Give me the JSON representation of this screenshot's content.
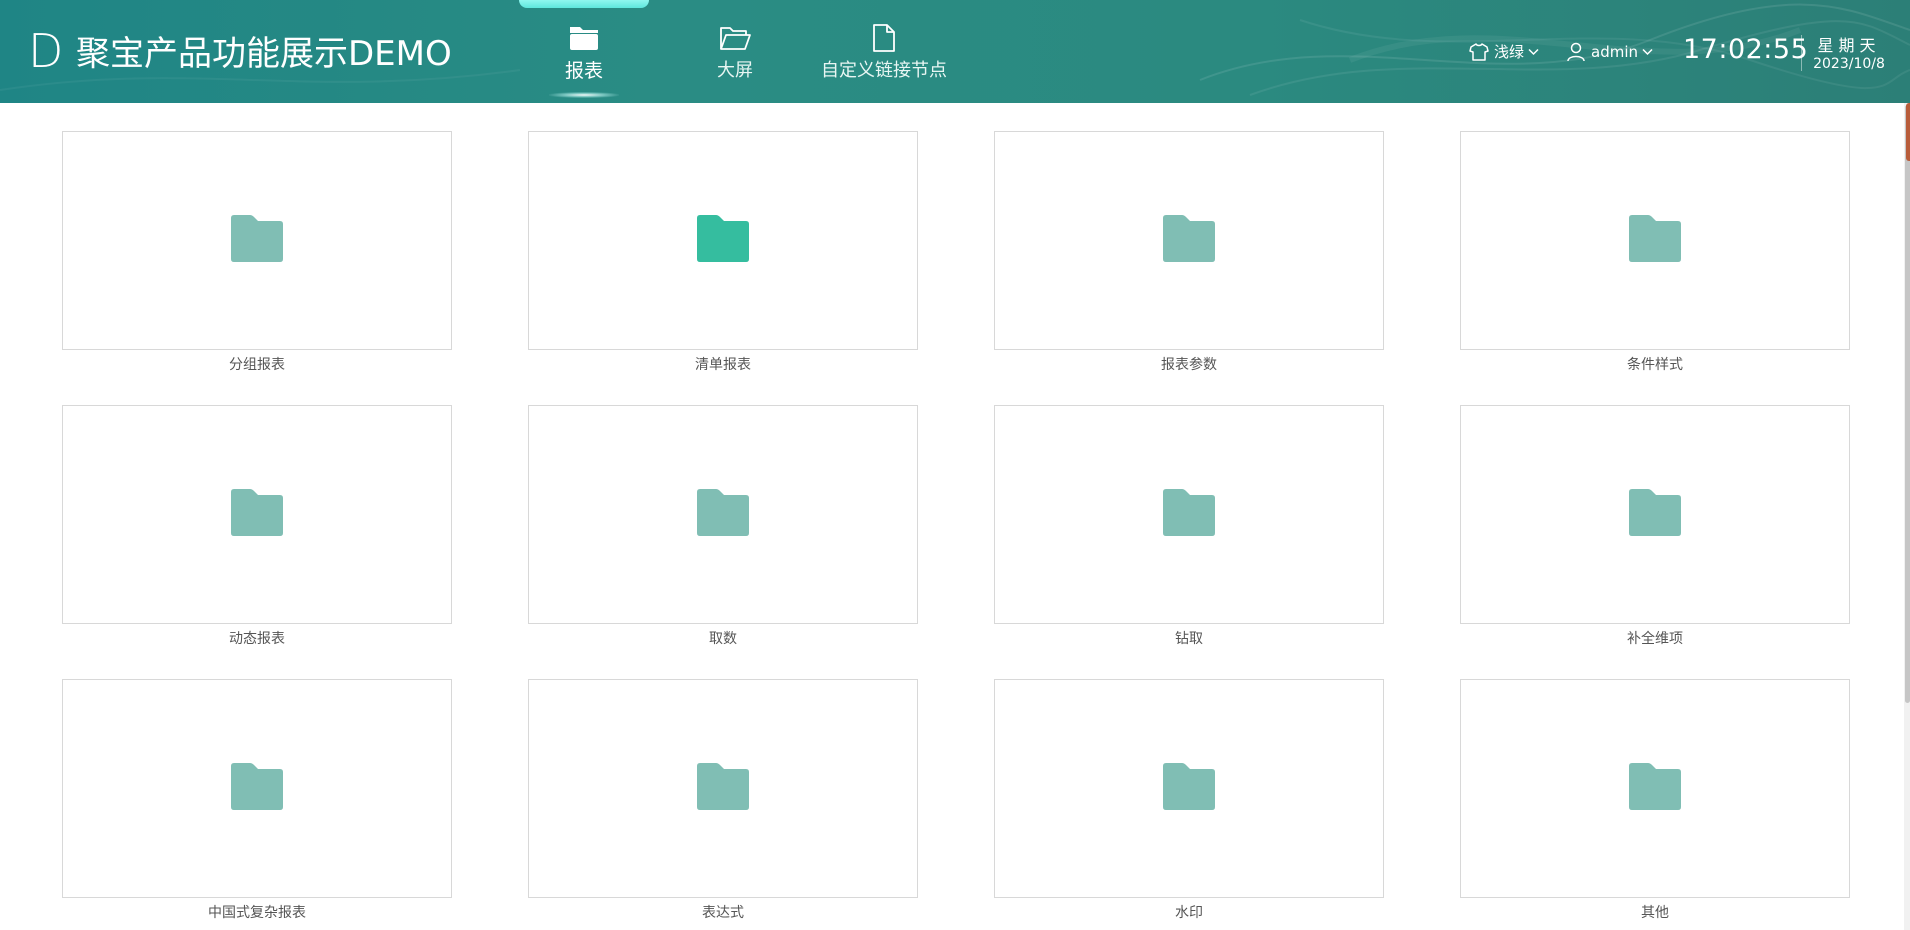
{
  "header": {
    "logo_letter": "D",
    "title": "聚宝产品功能展示DEMO",
    "tabs": [
      {
        "label": "报表",
        "icon": "folder-filled-icon",
        "active": true
      },
      {
        "label": "大屏",
        "icon": "folder-open-icon",
        "active": false
      },
      {
        "label": "自定义链接节点",
        "icon": "document-icon",
        "active": false
      }
    ],
    "theme": {
      "label": "浅绿",
      "icon": "shirt-icon"
    },
    "user": {
      "name": "admin",
      "icon": "user-icon"
    },
    "time": "17:02:55",
    "weekday": "星期天",
    "date": "2023/10/8"
  },
  "colors": {
    "header_start": "#1f8585",
    "header_end": "#2c7f77",
    "folder_default": "#80beb4",
    "folder_highlight": "#35bd9f",
    "active_tab_bar": "#6eeee4"
  },
  "folders": [
    {
      "label": "分组报表",
      "highlighted": false
    },
    {
      "label": "清单报表",
      "highlighted": true
    },
    {
      "label": "报表参数",
      "highlighted": false
    },
    {
      "label": "条件样式",
      "highlighted": false
    },
    {
      "label": "动态报表",
      "highlighted": false
    },
    {
      "label": "取数",
      "highlighted": false
    },
    {
      "label": "钻取",
      "highlighted": false
    },
    {
      "label": "补全维项",
      "highlighted": false
    },
    {
      "label": "中国式复杂报表",
      "highlighted": false
    },
    {
      "label": "表达式",
      "highlighted": false
    },
    {
      "label": "水印",
      "highlighted": false
    },
    {
      "label": "其他",
      "highlighted": false
    }
  ]
}
